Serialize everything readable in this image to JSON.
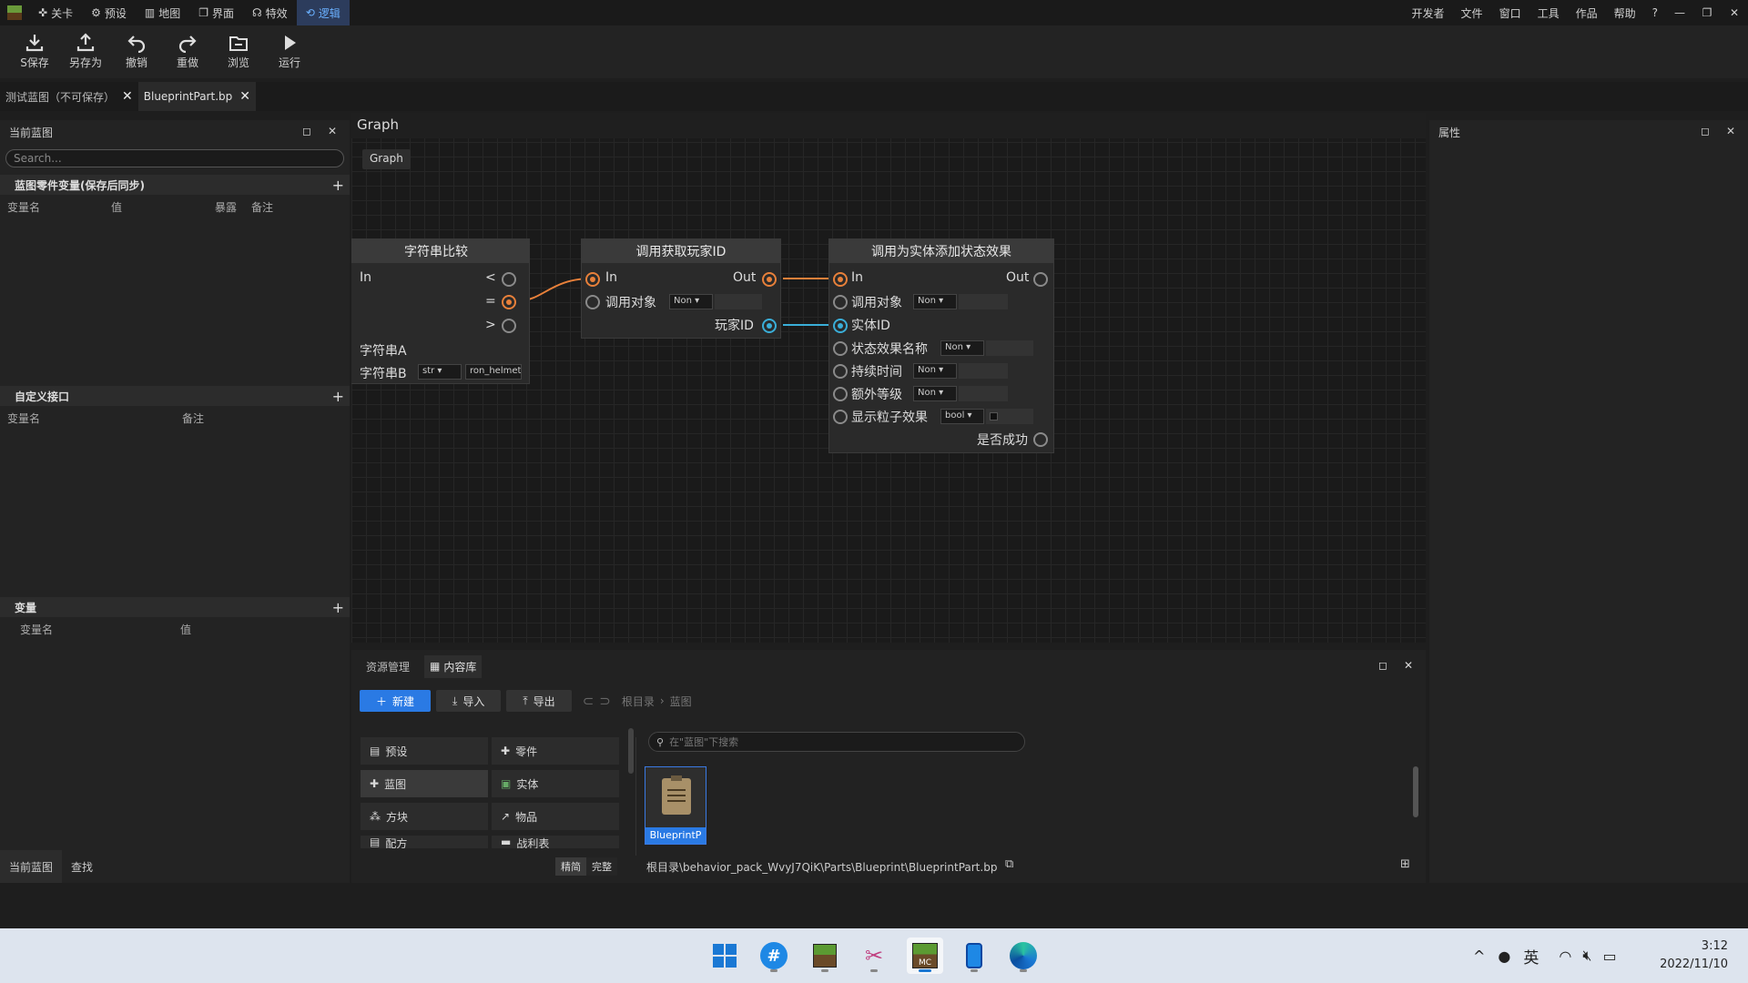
{
  "menubar": {
    "tabs": [
      {
        "icon": "crosshair-icon",
        "label": "关卡"
      },
      {
        "icon": "gear-icon",
        "label": "预设"
      },
      {
        "icon": "map-icon",
        "label": "地图"
      },
      {
        "icon": "window-icon",
        "label": "界面"
      },
      {
        "icon": "effect-icon",
        "label": "特效"
      },
      {
        "icon": "logic-icon",
        "label": "逻辑"
      }
    ],
    "right": [
      "开发者",
      "文件",
      "窗口",
      "工具",
      "作品",
      "帮助"
    ],
    "help": "?"
  },
  "toolbar": {
    "save": "S保存",
    "save_as": "另存为",
    "undo": "撤销",
    "redo": "重做",
    "browse": "浏览",
    "run": "运行"
  },
  "doc_tabs": [
    "测试蓝图（不可保存）",
    "BlueprintPart.bp"
  ],
  "left_panel": {
    "title": "当前蓝图",
    "search_placeholder": "Search...",
    "section1": "蓝图零件变量(保存后同步)",
    "section1_cols": [
      "变量名",
      "值",
      "暴露",
      "备注"
    ],
    "section2": "自定义接口",
    "section2_cols": [
      "变量名",
      "备注"
    ],
    "section3": "变量",
    "section3_cols": [
      "变量名",
      "值"
    ],
    "bottom_tabs": [
      "当前蓝图",
      "查找"
    ]
  },
  "graph": {
    "title": "Graph",
    "breadcrumb": "Graph",
    "node1": {
      "title": "字符串比较",
      "in": "In",
      "lt": "<",
      "eq": "=",
      "gt": ">",
      "a": "字符串A",
      "b": "字符串B",
      "b_type": "str",
      "b_value": "ron_helmet"
    },
    "node2": {
      "title": "调用获取玩家ID",
      "in": "In",
      "out": "Out",
      "target": "调用对象",
      "target_type": "Non",
      "player_id": "玩家ID"
    },
    "node3": {
      "title": "调用为实体添加状态效果",
      "in": "In",
      "out": "Out",
      "target": "调用对象",
      "target_type": "Non",
      "entity_id": "实体ID",
      "effect_name": "状态效果名称",
      "effect_type": "Non",
      "duration": "持续时间",
      "duration_type": "Non",
      "level": "额外等级",
      "level_type": "Non",
      "particles": "显示粒子效果",
      "particles_type": "bool",
      "success": "是否成功"
    }
  },
  "right_panel": {
    "title": "属性"
  },
  "assets": {
    "tabs": [
      "资源管理",
      "内容库"
    ],
    "new": "新建",
    "import": "导入",
    "export": "导出",
    "crumb_root": "根目录",
    "crumb_leaf": "蓝图",
    "search_placeholder": "在\"蓝图\"下搜索",
    "categories": [
      "预设",
      "零件",
      "蓝图",
      "实体",
      "方块",
      "物品",
      "配方",
      "战利表"
    ],
    "file_name": "BlueprintP",
    "view_simple": "精简",
    "view_full": "完整",
    "path": "根目录\\behavior_pack_WvyJ7QiK\\Parts\\Blueprint\\BlueprintPart.bp"
  },
  "taskbar": {
    "ime": "英",
    "time": "3:12",
    "date": "2022/11/10"
  },
  "colors": {
    "accent": "#2a7ae4",
    "exec_wire": "#e8803a",
    "data_wire": "#3aaed8"
  }
}
